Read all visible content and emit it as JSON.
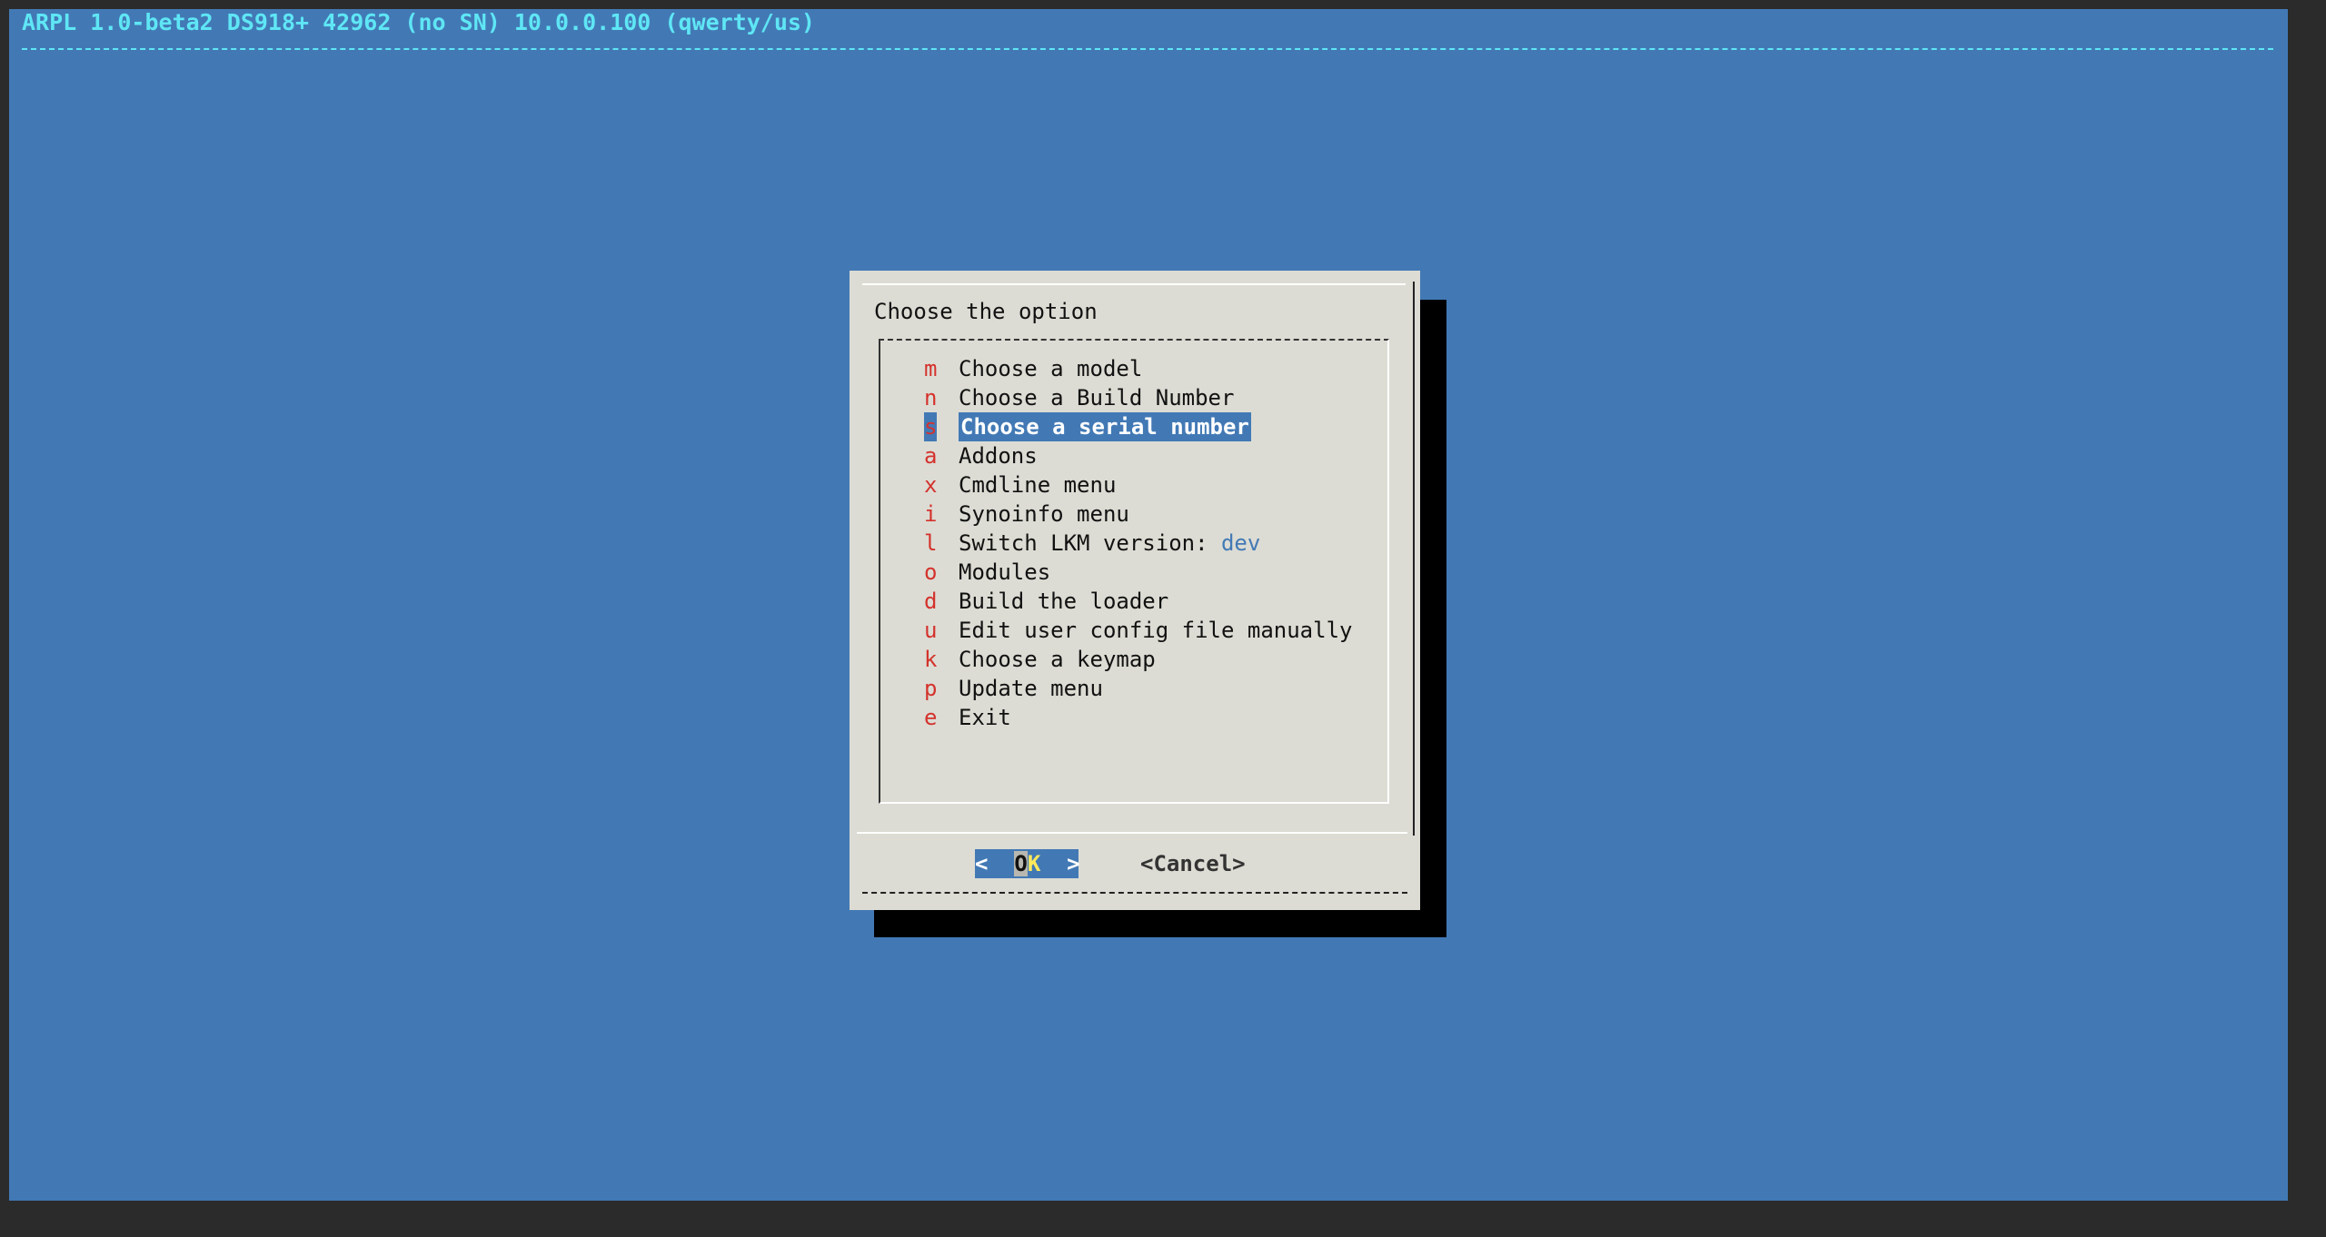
{
  "backtitle": "ARPL 1.0-beta2 DS918+ 42962 (no SN) 10.0.0.100 (qwerty/us)",
  "dialog": {
    "title": "Choose the option",
    "menu": [
      {
        "key": "m",
        "label": "Choose a model"
      },
      {
        "key": "n",
        "label": "Choose a Build Number"
      },
      {
        "key": "s",
        "label": "Choose a serial number",
        "selected": true
      },
      {
        "key": "a",
        "label": "Addons"
      },
      {
        "key": "x",
        "label": "Cmdline menu"
      },
      {
        "key": "i",
        "label": "Synoinfo menu"
      },
      {
        "key": "l",
        "label": "Switch LKM version: ",
        "value": "dev"
      },
      {
        "key": "o",
        "label": "Modules"
      },
      {
        "key": "d",
        "label": "Build the loader"
      },
      {
        "key": "u",
        "label": "Edit user config file manually"
      },
      {
        "key": "k",
        "label": "Choose a keymap"
      },
      {
        "key": "p",
        "label": "Update menu"
      },
      {
        "key": "e",
        "label": "Exit"
      }
    ],
    "buttons": {
      "ok_left": "<  ",
      "ok_hl": "O",
      "ok_key": "K",
      "ok_right": "  >",
      "cancel": "<Cancel>"
    }
  },
  "colors": {
    "background": "#4279b5",
    "backtitle": "#5fe6f5",
    "dialog": "#dcdcd4",
    "hotkey": "#d4322c",
    "selected_bg": "#4279b5"
  }
}
